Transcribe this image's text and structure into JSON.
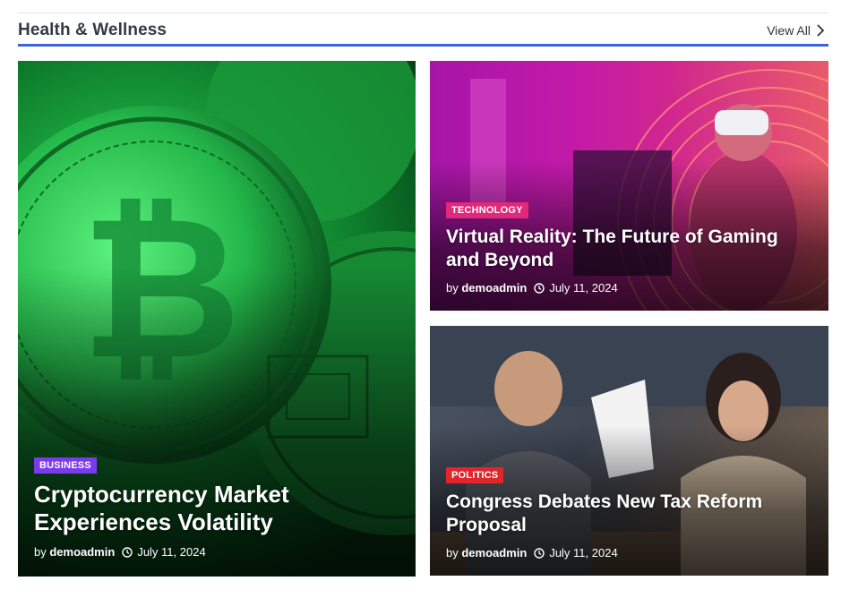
{
  "section": {
    "title": "Health & Wellness",
    "view_all_label": "View All"
  },
  "colors": {
    "accent_underline": "#3d65d6",
    "badge_business": "#7c3aed",
    "badge_technology": "#e0297a",
    "badge_politics": "#e0262b"
  },
  "posts": [
    {
      "category": "BUSINESS",
      "title": "Cryptocurrency Market Experiences Volatility",
      "by_label": "by",
      "author": "demoadmin",
      "date": "July 11, 2024",
      "image_icon": "bitcoin-coins-image"
    },
    {
      "category": "TECHNOLOGY",
      "title": "Virtual Reality: The Future of Gaming and Beyond",
      "by_label": "by",
      "author": "demoadmin",
      "date": "July 11, 2024",
      "image_icon": "vr-headset-image"
    },
    {
      "category": "POLITICS",
      "title": "Congress Debates New Tax Reform Proposal",
      "by_label": "by",
      "author": "demoadmin",
      "date": "July 11, 2024",
      "image_icon": "meeting-people-image"
    }
  ]
}
